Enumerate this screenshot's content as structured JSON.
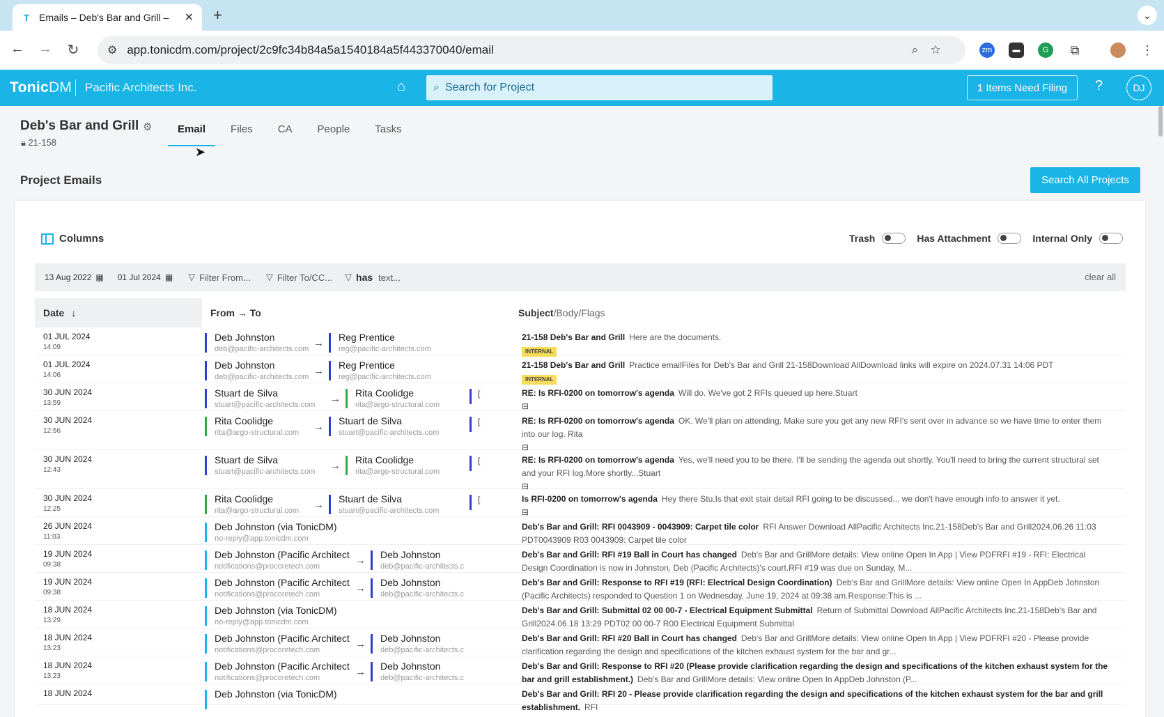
{
  "browser": {
    "tab_title": "Emails – Deb's Bar and Grill –",
    "favicon": "T",
    "url": "app.tonicdm.com/project/2c9fc34b84a5a1540184a5f443370040/email",
    "extensions": [
      "zm"
    ]
  },
  "app": {
    "logo": "Tonic",
    "logo_suffix": "DM",
    "company": "Pacific Architects Inc.",
    "search_placeholder": "Search for Project",
    "filing_button": "1 Items Need Filing",
    "help": "?",
    "user_initials": "DJ"
  },
  "project": {
    "title": "Deb's Bar and Grill",
    "number": "21-158",
    "tabs": [
      "Email",
      "Files",
      "CA",
      "People",
      "Tasks"
    ],
    "active_tab": "Email"
  },
  "section_title": "Project Emails",
  "search_all_button": "Search All Projects",
  "toolbar": {
    "columns_label": "Columns",
    "toggles": [
      "Trash",
      "Has Attachment",
      "Internal Only"
    ]
  },
  "filters": {
    "date_from": "13 Aug 2022",
    "date_to": "01 Jul 2024",
    "from_placeholder": "Filter From...",
    "to_placeholder": "Filter To/CC...",
    "has_label": "has",
    "text_placeholder": "text...",
    "clear_all": "clear all"
  },
  "table": {
    "col_date": "Date",
    "col_from_to": "From → To",
    "col_subject": "Subject",
    "col_subject_rest": "/Body/Flags",
    "rows": [
      {
        "date": "01 JUL 2024",
        "time": "14:09",
        "from": "Deb Johnston",
        "from_email": "deb@pacific-architects.com",
        "from_color": "#2f3ecf",
        "to": "Reg Prentice",
        "to_email": "reg@pacific-architects.com",
        "to_color": "#2f3ecf",
        "subject": "21-158 Deb's Bar and Grill",
        "body": "Here are the documents.",
        "badge": "INTERNAL"
      },
      {
        "date": "01 JUL 2024",
        "time": "14:06",
        "from": "Deb Johnston",
        "from_email": "deb@pacific-architects.com",
        "from_color": "#2f3ecf",
        "to": "Reg Prentice",
        "to_email": "reg@pacific-architects.com",
        "to_color": "#2f3ecf",
        "subject": "21-158 Deb's Bar and Grill",
        "body": "Practice emailFiles for Deb's Bar and Grill 21-158Download AllDownload links will expire on 2024.07.31 14:06 PDT",
        "badge": "INTERNAL"
      },
      {
        "date": "30 JUN 2024",
        "time": "13:59",
        "from": "Stuart de Silva",
        "from_email": "stuart@pacific-architects.com",
        "from_color": "#2f3ecf",
        "to": "Rita Coolidge",
        "to_email": "rita@argo-structural.com",
        "to_color": "#2ea84a",
        "more": "[",
        "subject": "RE: Is RFI-0200 on tomorrow's agenda",
        "body": "Will do. We've got 2 RFIs queued up here.Stuart",
        "attach": true
      },
      {
        "date": "30 JUN 2024",
        "time": "12:56",
        "from": "Rita Coolidge",
        "from_email": "rita@argo-structural.com",
        "from_color": "#2ea84a",
        "to": "Stuart de Silva",
        "to_email": "stuart@pacific-architects.com",
        "to_color": "#2f3ecf",
        "more": "[",
        "subject": "RE: Is RFI-0200 on tomorrow's agenda",
        "body": "OK. We'll plan on attending. Make sure you get any new RFI's sent over in advance so we have time to enter them into our log. Rita",
        "attach": true
      },
      {
        "date": "30 JUN 2024",
        "time": "12:43",
        "from": "Stuart de Silva",
        "from_email": "stuart@pacific-architects.com",
        "from_color": "#2f3ecf",
        "to": "Rita Coolidge",
        "to_email": "rita@argo-structural.com",
        "to_color": "#2ea84a",
        "more": "[",
        "subject": "RE: Is RFI-0200 on tomorrow's agenda",
        "body": "Yes, we'll need you to be there. I'll be sending the agenda out shortly. You'll need to bring the current structural set and your RFI log.More shortly...Stuart",
        "attach": true
      },
      {
        "date": "30 JUN 2024",
        "time": "12:25",
        "from": "Rita Coolidge",
        "from_email": "rita@argo-structural.com",
        "from_color": "#2ea84a",
        "to": "Stuart de Silva",
        "to_email": "stuart@pacific-architects.com",
        "to_color": "#2f3ecf",
        "more": "[",
        "subject": "Is RFI-0200 on tomorrow's agenda",
        "body": "Hey there Stu,Is that exit stair detail RFI going to be discussed... we don't have enough info to answer it yet.",
        "attach": true
      },
      {
        "date": "26 JUN 2024",
        "time": "11:03",
        "from": "Deb Johnston (via TonicDM)",
        "from_email": "no-reply@app.tonicdm.com",
        "from_color": "#1ab4e6",
        "subject": "Deb's Bar and Grill: RFI 0043909 - 0043909: Carpet tile color",
        "body": "RFI Answer     Download AllPacific Architects Inc.21-158Deb's Bar and Grill2024.06.26 11:03 PDT0043909 R03 0043909: Carpet tile color"
      },
      {
        "date": "19 JUN 2024",
        "time": "09:38",
        "from": "Deb Johnston (Pacific Architect",
        "from_email": "notifications@procoretech.com",
        "from_color": "#1ab4e6",
        "to": "Deb Johnston",
        "to_email": "deb@pacific-architects.c",
        "to_color": "#2f3ecf",
        "subject": "Deb's Bar and Grill: RFI #19 Ball in Court has changed",
        "body": "Deb's Bar and GrillMore details:  View online Open In App |  View PDFRFI #19 - RFI: Electrical Design Coordination is now in Johnston, Deb (Pacific Architects)'s court.RFI #19 was due on Sunday, M..."
      },
      {
        "date": "19 JUN 2024",
        "time": "09:38",
        "from": "Deb Johnston (Pacific Architect",
        "from_email": "notifications@procoretech.com",
        "from_color": "#1ab4e6",
        "to": "Deb Johnston",
        "to_email": "deb@pacific-architects.c",
        "to_color": "#2f3ecf",
        "subject": "Deb's Bar and Grill: Response to RFI #19 (RFI: Electrical Design Coordination)",
        "body": "Deb's Bar and GrillMore details:  View online Open In AppDeb Johnston (Pacific Architects) responded to Question 1 on Wednesday, June 19, 2024 at 09:38 am.Response:This is ..."
      },
      {
        "date": "18 JUN 2024",
        "time": "13:29",
        "from": "Deb Johnston (via TonicDM)",
        "from_email": "no-reply@app.tonicdm.com",
        "from_color": "#1ab4e6",
        "subject": "Deb's Bar and Grill: Submittal 02 00 00-7 - Electrical Equipment Submittal",
        "body": "Return of Submittal     Download AllPacific Architects Inc.21-158Deb's Bar and Grill2024.06.18 13:29 PDT02 00 00-7 R00 Electrical Equipment Submittal"
      },
      {
        "date": "18 JUN 2024",
        "time": "13:23",
        "from": "Deb Johnston (Pacific Architect",
        "from_email": "notifications@procoretech.com",
        "from_color": "#1ab4e6",
        "to": "Deb Johnston",
        "to_email": "deb@pacific-architects.c",
        "to_color": "#2f3ecf",
        "subject": "Deb's Bar and Grill: RFI #20 Ball in Court has changed",
        "body": "Deb's Bar and GrillMore details:  View online Open In App |  View PDFRFI #20 - Please provide clarification regarding the design and specifications of the kitchen exhaust system for the bar and gr..."
      },
      {
        "date": "18 JUN 2024",
        "time": "13:23",
        "from": "Deb Johnston (Pacific Architect",
        "from_email": "notifications@procoretech.com",
        "from_color": "#1ab4e6",
        "to": "Deb Johnston",
        "to_email": "deb@pacific-architects.c",
        "to_color": "#2f3ecf",
        "subject": "Deb's Bar and Grill: Response to RFI #20 (Please provide clarification regarding the design and specifications of the kitchen exhaust system for the bar and grill establishment.)",
        "body": "Deb's Bar and GrillMore details:  View online Open In AppDeb Johnston (P..."
      },
      {
        "date": "18 JUN 2024",
        "time": "",
        "from": "Deb Johnston (via TonicDM)",
        "from_email": "",
        "from_color": "#1ab4e6",
        "subject": "Deb's Bar and Grill: RFI 20 - Please provide clarification regarding the design and specifications of the kitchen exhaust system for the bar and grill establishment.",
        "body": "RFI"
      }
    ]
  }
}
